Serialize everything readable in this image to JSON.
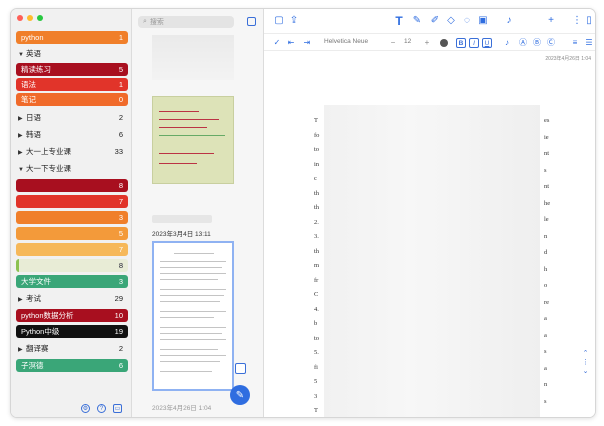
{
  "sidebar": {
    "top_item": {
      "label": "python",
      "count": "1",
      "color": "#f07f2a"
    },
    "groups": [
      {
        "label": "英语",
        "expanded": true,
        "count": "",
        "children": [
          {
            "label": "精读练习",
            "count": "5",
            "color": "#a80f1f"
          },
          {
            "label": "语法",
            "count": "1",
            "color": "#e1342a"
          },
          {
            "label": "笔记",
            "count": "0",
            "color": "#f06a2a"
          }
        ]
      },
      {
        "label": "日语",
        "expanded": false,
        "count": "2"
      },
      {
        "label": "韩语",
        "expanded": false,
        "count": "6"
      },
      {
        "label": "大一上专业课",
        "expanded": false,
        "count": "33"
      },
      {
        "label": "大一下专业课",
        "expanded": true,
        "count": "",
        "children": [
          {
            "label": "",
            "count": "8",
            "color": "#a80f1f"
          },
          {
            "label": "",
            "count": "7",
            "color": "#e1342a"
          },
          {
            "label": "",
            "count": "3",
            "color": "#f07f2a"
          },
          {
            "label": "",
            "count": "5",
            "color": "#f39a3a"
          },
          {
            "label": "",
            "count": "7",
            "color": "#f6b85a"
          },
          {
            "label": "",
            "count": "8",
            "color": "#e8ecd6"
          },
          {
            "label": "大学文件",
            "count": "3",
            "color": "#3aa678"
          }
        ]
      },
      {
        "label": "考试",
        "expanded": false,
        "count": "29"
      }
    ],
    "bottom_items": [
      {
        "label": "python数据分析",
        "count": "10",
        "color": "#a80f1f"
      },
      {
        "label": "Python中级",
        "count": "19",
        "color": "#111111"
      },
      {
        "label": "翻译赛",
        "count": "2",
        "color": ""
      },
      {
        "label": "子溟德",
        "count": "6",
        "color": "#3aa678"
      }
    ]
  },
  "notes": {
    "search_placeholder": "搜索",
    "items": [
      {
        "date": "2023年3月4日 13:11"
      },
      {
        "date": "2023年4月26日 1:04"
      }
    ]
  },
  "editor": {
    "font_name": "Helvetica Neue",
    "font_size": "12",
    "bold": "B",
    "italic": "I",
    "underline": "U",
    "page_stamp": "2023年4月26日 1:04",
    "margin_left_chars": [
      "T",
      "fo",
      "to",
      "in",
      "c",
      "th",
      "th",
      "2.",
      "3.",
      "th",
      "m",
      "fr",
      "C",
      "4.",
      "b",
      "to",
      "5.",
      "fi",
      "5",
      "3",
      "T"
    ],
    "margin_right_chars": [
      "es",
      "ie",
      "nt",
      "s",
      "nt",
      "he",
      "le",
      "n",
      "d",
      "h",
      "o",
      "re",
      "a",
      "a",
      "s",
      "a",
      "n",
      "s"
    ]
  }
}
